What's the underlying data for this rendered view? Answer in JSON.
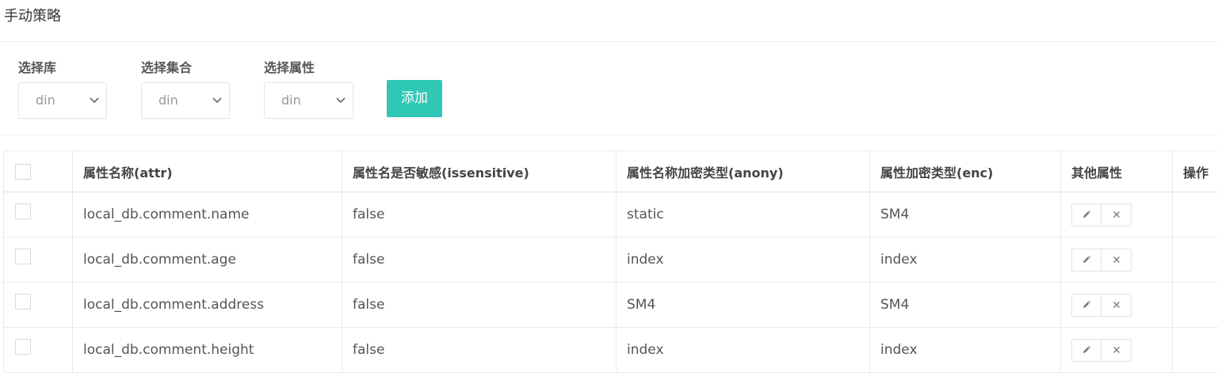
{
  "page": {
    "title": "手动策略"
  },
  "filters": [
    {
      "label": "选择库",
      "value": "din"
    },
    {
      "label": "选择集合",
      "value": "din"
    },
    {
      "label": "选择属性",
      "value": "din"
    }
  ],
  "add_button": {
    "label": "添加",
    "color": "#2fc7b5"
  },
  "table": {
    "headers": {
      "attr": "属性名称(attr)",
      "issensitive": "属性名是否敏感(issensitive)",
      "anony": "属性名称加密类型(anony)",
      "enc": "属性加密类型(enc)",
      "other": "其他属性",
      "ops": "操作"
    },
    "rows": [
      {
        "attr": "local_db.comment.name",
        "issensitive": "false",
        "anony": "static",
        "enc": "SM4"
      },
      {
        "attr": "local_db.comment.age",
        "issensitive": "false",
        "anony": "index",
        "enc": "index"
      },
      {
        "attr": "local_db.comment.address",
        "issensitive": "false",
        "anony": "SM4",
        "enc": "SM4"
      },
      {
        "attr": "local_db.comment.height",
        "issensitive": "false",
        "anony": "index",
        "enc": "index"
      }
    ],
    "row_actions": {
      "edit_icon": "pencil-icon",
      "delete_icon": "close-icon"
    }
  }
}
